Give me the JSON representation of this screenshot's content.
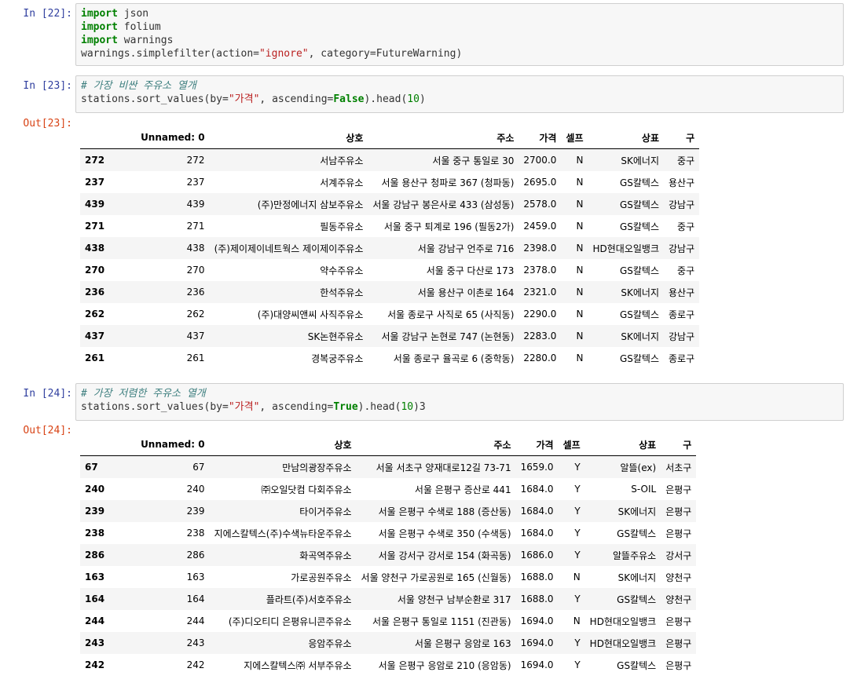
{
  "cell22": {
    "prompt": "In [22]:",
    "lines": [
      [
        {
          "t": "kw",
          "v": "import"
        },
        {
          "t": "",
          "v": " json"
        }
      ],
      [
        {
          "t": "kw",
          "v": "import"
        },
        {
          "t": "",
          "v": " folium"
        }
      ],
      [
        {
          "t": "kw",
          "v": "import"
        },
        {
          "t": "",
          "v": " warnings"
        }
      ],
      [
        {
          "t": "",
          "v": "warnings.simplefilter(action="
        },
        {
          "t": "str",
          "v": "\"ignore\""
        },
        {
          "t": "",
          "v": ", category=FutureWarning)"
        }
      ]
    ]
  },
  "cell23": {
    "prompt": "In [23]:",
    "out_prompt": "Out[23]:",
    "lines": [
      [
        {
          "t": "cm",
          "v": "# 가장 비싼 주유소 열개"
        }
      ],
      [
        {
          "t": "",
          "v": "stations.sort_values(by="
        },
        {
          "t": "str",
          "v": "\"가격\""
        },
        {
          "t": "",
          "v": ", ascending="
        },
        {
          "t": "bool",
          "v": "False"
        },
        {
          "t": "",
          "v": ").head("
        },
        {
          "t": "num",
          "v": "10"
        },
        {
          "t": "",
          "v": ")"
        }
      ]
    ],
    "columns": [
      "",
      "Unnamed: 0",
      "상호",
      "주소",
      "가격",
      "셀프",
      "상표",
      "구"
    ],
    "rows": [
      [
        "272",
        "272",
        "서남주유소",
        "서울 중구 통일로 30",
        "2700.0",
        "N",
        "SK에너지",
        "중구"
      ],
      [
        "237",
        "237",
        "서계주유소",
        "서울 용산구 청파로 367 (청파동)",
        "2695.0",
        "N",
        "GS칼텍스",
        "용산구"
      ],
      [
        "439",
        "439",
        "(주)만정에너지 삼보주유소",
        "서울 강남구 봉은사로 433 (삼성동)",
        "2578.0",
        "N",
        "GS칼텍스",
        "강남구"
      ],
      [
        "271",
        "271",
        "필동주유소",
        "서울 중구 퇴계로 196 (필동2가)",
        "2459.0",
        "N",
        "GS칼텍스",
        "중구"
      ],
      [
        "438",
        "438",
        "(주)제이제이네트웍스 제이제이주유소",
        "서울 강남구 언주로 716",
        "2398.0",
        "N",
        "HD현대오일뱅크",
        "강남구"
      ],
      [
        "270",
        "270",
        "약수주유소",
        "서울 중구 다산로 173",
        "2378.0",
        "N",
        "GS칼텍스",
        "중구"
      ],
      [
        "236",
        "236",
        "한석주유소",
        "서울 용산구 이촌로 164",
        "2321.0",
        "N",
        "SK에너지",
        "용산구"
      ],
      [
        "262",
        "262",
        "(주)대양씨앤씨 사직주유소",
        "서울 종로구 사직로 65 (사직동)",
        "2290.0",
        "N",
        "GS칼텍스",
        "종로구"
      ],
      [
        "437",
        "437",
        "SK논현주유소",
        "서울 강남구 논현로 747 (논현동)",
        "2283.0",
        "N",
        "SK에너지",
        "강남구"
      ],
      [
        "261",
        "261",
        "경복궁주유소",
        "서울 종로구 율곡로 6 (중학동)",
        "2280.0",
        "N",
        "GS칼텍스",
        "종로구"
      ]
    ]
  },
  "cell24": {
    "prompt": "In [24]:",
    "out_prompt": "Out[24]:",
    "lines": [
      [
        {
          "t": "cm",
          "v": "# 가장 저렴한 주유소 열개"
        }
      ],
      [
        {
          "t": "",
          "v": "stations.sort_values(by="
        },
        {
          "t": "str",
          "v": "\"가격\""
        },
        {
          "t": "",
          "v": ", ascending="
        },
        {
          "t": "bool",
          "v": "True"
        },
        {
          "t": "",
          "v": ").head("
        },
        {
          "t": "num",
          "v": "10"
        },
        {
          "t": "",
          "v": ")3"
        }
      ]
    ],
    "columns": [
      "",
      "Unnamed: 0",
      "상호",
      "주소",
      "가격",
      "셀프",
      "상표",
      "구"
    ],
    "rows": [
      [
        "67",
        "67",
        "만남의광장주유소",
        "서울 서초구 양재대로12길 73-71",
        "1659.0",
        "Y",
        "알뜰(ex)",
        "서초구"
      ],
      [
        "240",
        "240",
        "㈜오일닷컴 다회주유소",
        "서울 은평구 증산로 441",
        "1684.0",
        "Y",
        "S-OIL",
        "은평구"
      ],
      [
        "239",
        "239",
        "타이거주유소",
        "서울 은평구 수색로 188 (증산동)",
        "1684.0",
        "Y",
        "SK에너지",
        "은평구"
      ],
      [
        "238",
        "238",
        "지에스칼텍스(주)수색뉴타운주유소",
        "서울 은평구 수색로 350 (수색동)",
        "1684.0",
        "Y",
        "GS칼텍스",
        "은평구"
      ],
      [
        "286",
        "286",
        "화곡역주유소",
        "서울 강서구 강서로 154 (화곡동)",
        "1686.0",
        "Y",
        "알뜰주유소",
        "강서구"
      ],
      [
        "163",
        "163",
        "가로공원주유소",
        "서울 양천구 가로공원로 165 (신월동)",
        "1688.0",
        "N",
        "SK에너지",
        "양천구"
      ],
      [
        "164",
        "164",
        "플라트(주)서호주유소",
        "서울 양천구 남부순환로 317",
        "1688.0",
        "Y",
        "GS칼텍스",
        "양천구"
      ],
      [
        "244",
        "244",
        "(주)디오티디 은평유니콘주유소",
        "서울 은평구 통일로 1151 (진관동)",
        "1694.0",
        "N",
        "HD현대오일뱅크",
        "은평구"
      ],
      [
        "243",
        "243",
        "응암주유소",
        "서울 은평구 응암로 163",
        "1694.0",
        "Y",
        "HD현대오일뱅크",
        "은평구"
      ],
      [
        "242",
        "242",
        "지에스칼텍스㈜ 서부주유소",
        "서울 은평구 응암로 210 (응암동)",
        "1694.0",
        "Y",
        "GS칼텍스",
        "은평구"
      ]
    ]
  }
}
